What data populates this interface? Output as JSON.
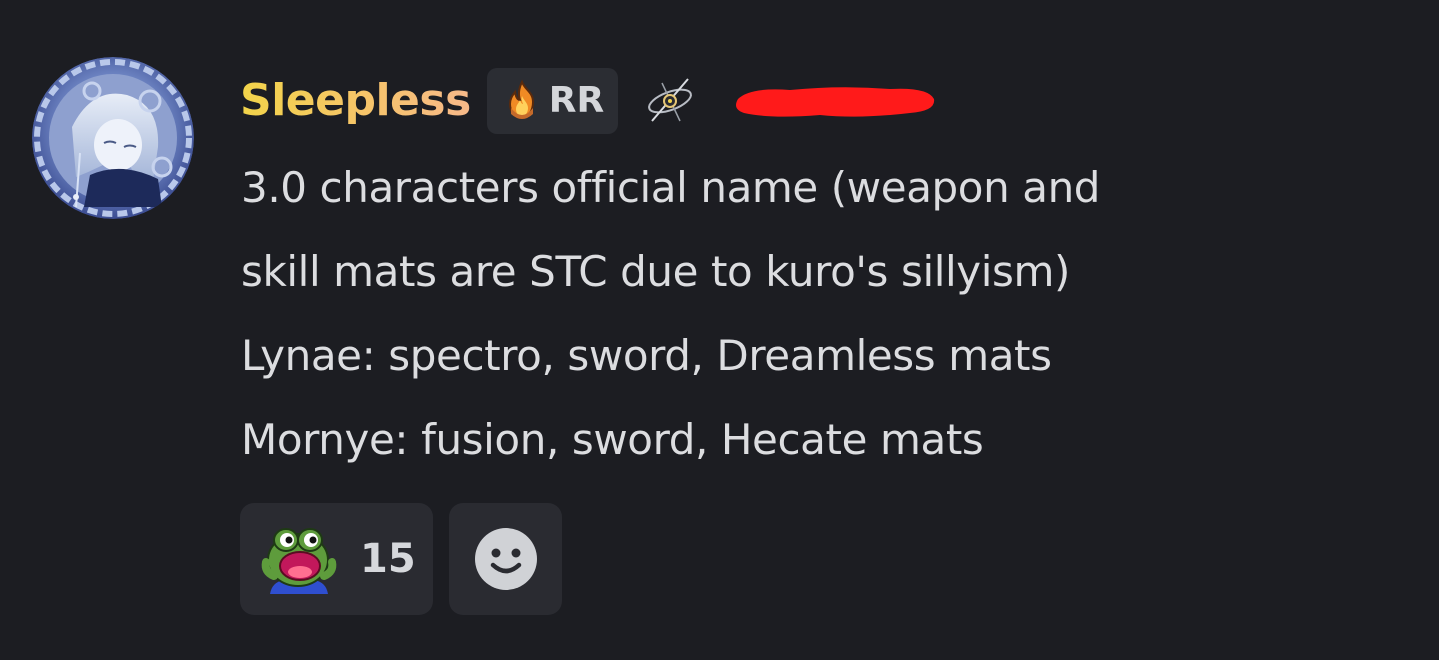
{
  "message": {
    "author": {
      "username": "Sleepless",
      "avatar_icon": "avatar-anime-girl",
      "tag": {
        "icon": "flame-icon",
        "label": "RR"
      },
      "decoration_icon": "compass-icon",
      "redaction_color": "#ff1a1a"
    },
    "content_lines": [
      "3.0 characters official name (weapon and",
      "skill mats are STC due to kuro's sillyism)",
      "Lynae: spectro, sword, Dreamless mats",
      "Mornye: fusion, sword, Hecate mats"
    ],
    "reactions": [
      {
        "emoji": "pepe-shocked-emoji",
        "count": "15"
      }
    ],
    "add_reaction": {
      "icon": "smiley-icon"
    }
  },
  "colors": {
    "background": "#1c1d22",
    "username_gradient_start": "#f2d44a",
    "username_gradient_end": "#f7b98a",
    "text": "#dcdde0",
    "chip_background": "#2a2b31"
  }
}
